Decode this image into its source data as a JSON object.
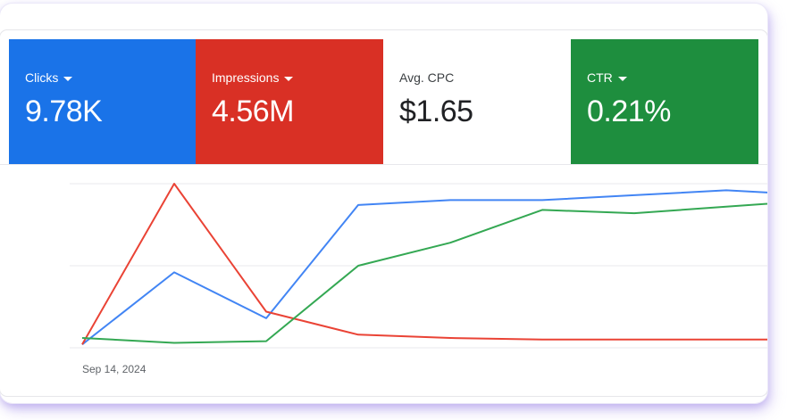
{
  "metrics": {
    "clicks": {
      "label": "Clicks",
      "value": "9.78K",
      "color": "#1a73e8",
      "has_dropdown": true
    },
    "impressions": {
      "label": "Impressions",
      "value": "4.56M",
      "color": "#d93025",
      "has_dropdown": true
    },
    "avg_cpc": {
      "label": "Avg. CPC",
      "value": "$1.65",
      "color": "#ffffff",
      "has_dropdown": false
    },
    "ctr": {
      "label": "CTR",
      "value": "0.21%",
      "color": "#1e8e3e",
      "has_dropdown": true
    }
  },
  "chart_data": {
    "type": "line",
    "x": [
      "Sep 14, 2024",
      "",
      "",
      "",
      "",
      "",
      "",
      "",
      ""
    ],
    "first_date_label": "Sep 14, 2024",
    "ylim": [
      0,
      100
    ],
    "grid": true,
    "series": [
      {
        "name": "Clicks",
        "color": "#4285f4",
        "values": [
          2,
          46,
          18,
          87,
          90,
          90,
          93,
          96,
          93
        ]
      },
      {
        "name": "Impressions",
        "color": "#ea4335",
        "values": [
          2,
          100,
          22,
          8,
          6,
          5,
          5,
          5,
          5
        ]
      },
      {
        "name": "CTR",
        "color": "#34a853",
        "values": [
          6,
          3,
          4,
          50,
          64,
          84,
          82,
          86,
          90
        ]
      }
    ]
  }
}
